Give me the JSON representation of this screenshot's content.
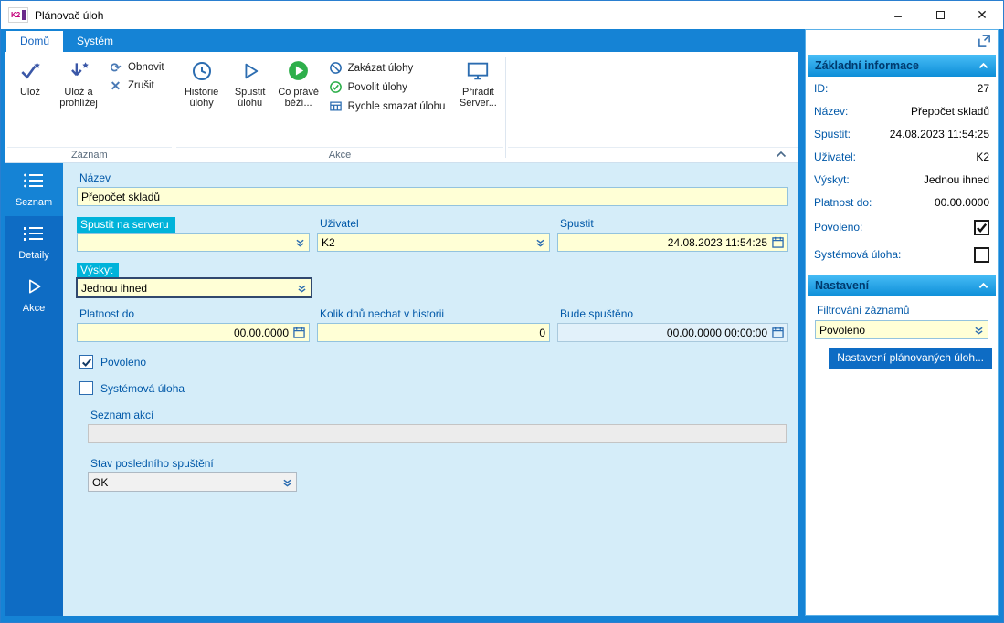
{
  "window": {
    "title": "Plánovač úloh"
  },
  "icons": {
    "minimize": "–",
    "close": "✕",
    "refresh": "⟳",
    "cancel": "✕",
    "grid": "▦"
  },
  "colors": {
    "frame_blue": "#1583d5",
    "sidebar_blue": "#0e6cc4",
    "field_yellow": "#ffffd6",
    "chip_cyan": "#00b3da",
    "label_blue": "#0058a8",
    "header_gradient_top": "#47bdf6",
    "header_gradient_bottom": "#0d8ed8",
    "green": "#2eaf4b"
  },
  "ribbon": {
    "tabs": [
      {
        "label": "Domů"
      },
      {
        "label": "Systém"
      }
    ],
    "groups": [
      {
        "label": "Záznam"
      },
      {
        "label": "Akce"
      }
    ],
    "buttons": {
      "save": "Ulož",
      "save_view": "Ulož a prohlížej",
      "refresh": "Obnovit",
      "cancel": "Zrušit",
      "history": "Historie úlohy",
      "run": "Spustit úlohu",
      "running": "Co právě běží...",
      "disable": "Zakázat úlohy",
      "enable": "Povolit úlohy",
      "quick_delete": "Rychle smazat úlohu",
      "assign_server": "Přiřadit Server..."
    }
  },
  "sidebar": {
    "items": [
      {
        "label": "Seznam"
      },
      {
        "label": "Detaily"
      },
      {
        "label": "Akce"
      }
    ]
  },
  "form": {
    "nazev": {
      "label": "Název",
      "value": "Přepočet skladů"
    },
    "spustit_na_serveru": {
      "label": "Spustit na serveru",
      "value": ""
    },
    "uzivatel": {
      "label": "Uživatel",
      "value": "K2"
    },
    "spustit": {
      "label": "Spustit",
      "value": "24.08.2023 11:54:25"
    },
    "vyskyt": {
      "label": "Výskyt",
      "value": "Jednou ihned"
    },
    "platnost_do": {
      "label": "Platnost do",
      "value": "00.00.0000"
    },
    "kolik_dnu": {
      "label": "Kolik dnů nechat v historii",
      "value": "0"
    },
    "bude_spusteno": {
      "label": "Bude spuštěno",
      "value": "00.00.0000 00:00:00"
    },
    "povoleno": {
      "label": "Povoleno",
      "checked": true
    },
    "systemova_uloha": {
      "label": "Systémová úloha",
      "checked": false
    },
    "seznam_akci": {
      "label": "Seznam akcí",
      "value": ""
    },
    "stav": {
      "label": "Stav posledního spuštění",
      "value": "OK"
    }
  },
  "panel": {
    "info": {
      "title": "Základní informace",
      "rows": [
        {
          "label": "ID:",
          "value": "27"
        },
        {
          "label": "Název:",
          "value": "Přepočet skladů"
        },
        {
          "label": "Spustit:",
          "value": "24.08.2023 11:54:25"
        },
        {
          "label": "Uživatel:",
          "value": "K2"
        },
        {
          "label": "Výskyt:",
          "value": "Jednou ihned"
        },
        {
          "label": "Platnost do:",
          "value": "00.00.0000"
        }
      ],
      "povoleno_label": "Povoleno:",
      "systemova_label": "Systémová úloha:"
    },
    "settings": {
      "title": "Nastavení",
      "filter_label": "Filtrování záznamů",
      "filter_value": "Povoleno",
      "button": "Nastavení plánovaných úloh..."
    }
  }
}
